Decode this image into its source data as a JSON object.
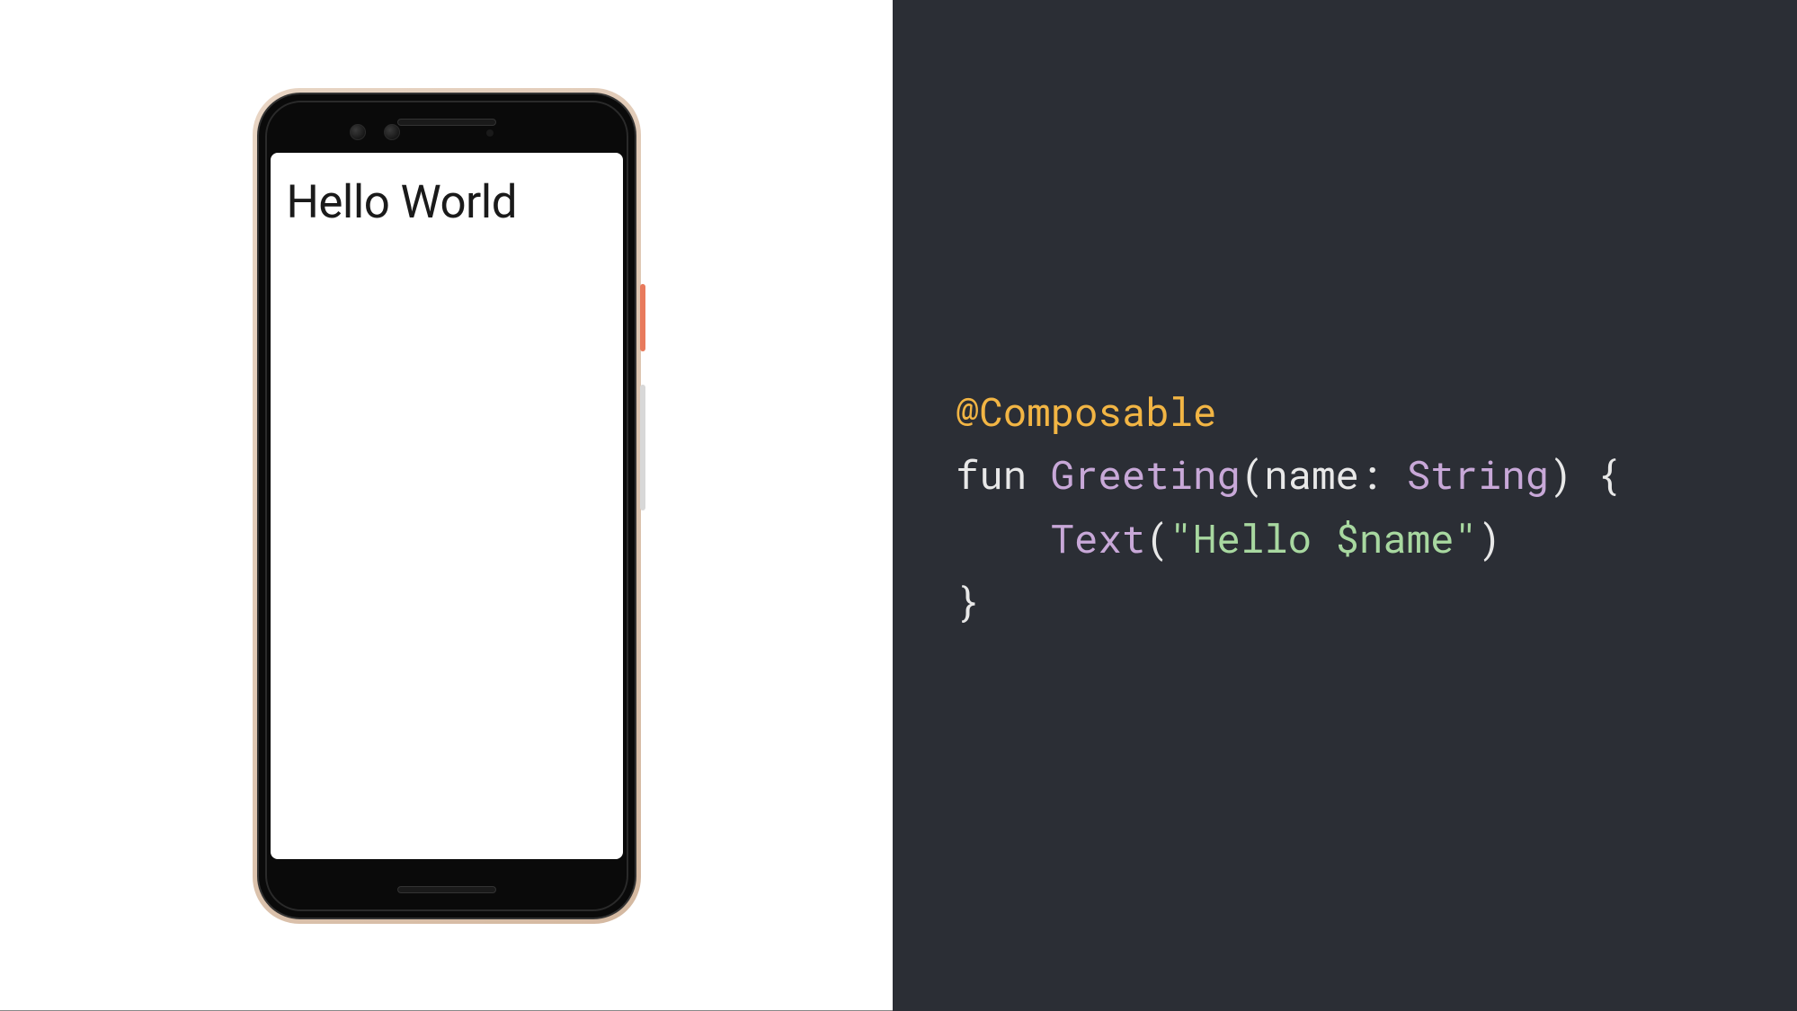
{
  "phone": {
    "screen_text": "Hello World"
  },
  "code": {
    "annotation": "@Composable",
    "keyword_fun": "fun",
    "func_name": "Greeting",
    "paren_open": "(",
    "param_name": "name",
    "colon": ":",
    "param_type": "String",
    "paren_close": ")",
    "brace_open": "{",
    "indent": "    ",
    "text_call": "Text",
    "call_open": "(",
    "string_literal": "\"Hello $name\"",
    "call_close": ")",
    "brace_close": "}"
  }
}
